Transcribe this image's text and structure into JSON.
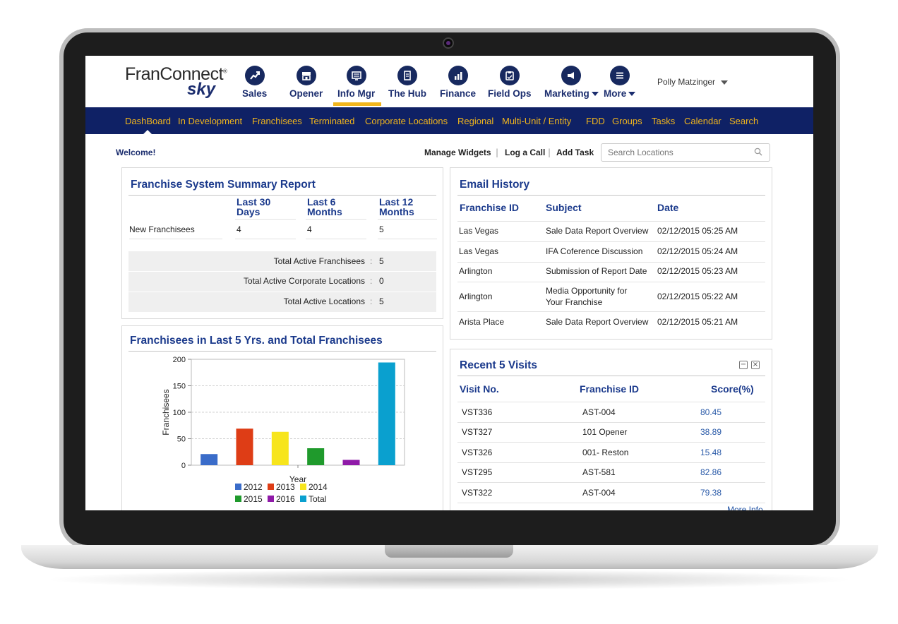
{
  "app": {
    "logo_line1": "FranConnect",
    "logo_reg": "®",
    "logo_line2": "sky",
    "user_name": "Polly Matzinger",
    "accent_color": "#f1b51c",
    "brand_color": "#0f2165"
  },
  "main_nav": [
    {
      "label": "Sales",
      "icon": "trend-up-icon"
    },
    {
      "label": "Opener",
      "icon": "store-icon"
    },
    {
      "label": "Info Mgr",
      "icon": "monitor-list-icon"
    },
    {
      "label": "The Hub",
      "icon": "document-icon"
    },
    {
      "label": "Finance",
      "icon": "bar-chart-icon"
    },
    {
      "label": "Field Ops",
      "icon": "clipboard-icon"
    },
    {
      "label": "Marketing",
      "icon": "megaphone-icon"
    },
    {
      "label": "More",
      "icon": "hamburger-icon"
    }
  ],
  "sub_nav": [
    "DashBoard",
    "In Development",
    "Franchisees",
    "Terminated",
    "Corporate Locations",
    "Regional",
    "Multi-Unit / Entity",
    "FDD",
    "Groups",
    "Tasks",
    "Calendar",
    "Search"
  ],
  "toolbar": {
    "welcome": "Welcome!",
    "manage_widgets": "Manage Widgets",
    "log_call": "Log a Call",
    "add_task": "Add Task",
    "separator": "|",
    "search_placeholder": "Search Locations"
  },
  "summary": {
    "title": "Franchise System Summary Report",
    "col1_line1": "Last 30",
    "col1_line2": "Days",
    "col2_line1": "Last 6",
    "col2_line2": "Months",
    "col3_line1": "Last 12",
    "col3_line2": "Months",
    "row_label": "New Franchisees",
    "row_values": [
      "4",
      "4",
      "5"
    ],
    "colon": ":",
    "totals": [
      {
        "label": "Total Active Franchisees",
        "value": "5"
      },
      {
        "label": "Total Active Corporate Locations",
        "value": "0"
      },
      {
        "label": "Total Active Locations",
        "value": "5"
      }
    ]
  },
  "email_history": {
    "title": "Email History",
    "headers": [
      "Franchise ID",
      "Subject",
      "Date"
    ],
    "rows": [
      {
        "id": "Las Vegas",
        "subject": "Sale Data Report Overview",
        "subject2": "",
        "date": "02/12/2015 05:25 AM"
      },
      {
        "id": "Las Vegas",
        "subject": "IFA Coference Discussion",
        "subject2": "",
        "date": "02/12/2015 05:24 AM"
      },
      {
        "id": "Arlington",
        "subject": "Submission of Report Date",
        "subject2": "",
        "date": "02/12/2015 05:23 AM"
      },
      {
        "id": "Arlington",
        "subject": "Media Opportunity for",
        "subject2": "Your Franchise",
        "date": "02/12/2015 05:22 AM"
      },
      {
        "id": "Arista Place",
        "subject": "Sale Data Report Overview",
        "subject2": "",
        "date": "02/12/2015 05:21 AM"
      }
    ]
  },
  "visits": {
    "title": "Recent 5 Visits",
    "minimize": "−",
    "close": "×",
    "headers": [
      "Visit No.",
      "Franchise ID",
      "Score(%)"
    ],
    "rows": [
      {
        "visit": "VST336",
        "id": "AST-004",
        "score": "80.45"
      },
      {
        "visit": "VST327",
        "id": "101 Opener",
        "score": "38.89"
      },
      {
        "visit": "VST326",
        "id": "001- Reston",
        "score": "15.48"
      },
      {
        "visit": "VST295",
        "id": "AST-581",
        "score": "82.86"
      },
      {
        "visit": "VST322",
        "id": "AST-004",
        "score": "79.38"
      }
    ],
    "more_info": "More Info"
  },
  "chart_title": "Franchisees in Last 5 Yrs. and Total Franchisees",
  "chart_data": {
    "type": "bar",
    "categories": [
      "2012",
      "2013",
      "2014",
      "2015",
      "2016",
      "Total"
    ],
    "values": [
      21,
      69,
      63,
      32,
      10,
      194
    ],
    "colors": [
      "#3a6cc9",
      "#de3d16",
      "#f7e51c",
      "#1f9a2c",
      "#8f1aa8",
      "#0aa0cf"
    ],
    "xlabel": "Year",
    "ylabel": "Franchisees",
    "ylim": [
      0,
      200
    ],
    "yticks": [
      0,
      50,
      100,
      150,
      200
    ],
    "grid": true,
    "legend": "bottom"
  }
}
